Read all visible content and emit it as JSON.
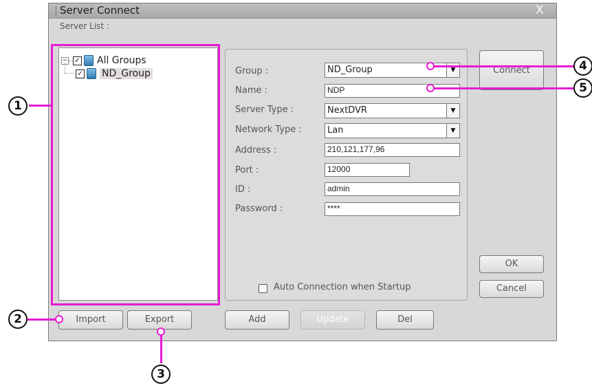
{
  "window": {
    "title": "Server Connect",
    "close_glyph": "X"
  },
  "server_list": {
    "label": "Server List :",
    "tree": [
      {
        "label": "All Groups",
        "expander": "−",
        "checked": true,
        "icon": "server-icon"
      },
      {
        "label": "ND_Group",
        "checked": true,
        "icon": "server-icon",
        "selected": true
      }
    ]
  },
  "form": {
    "group": {
      "label": "Group :",
      "value": "ND_Group"
    },
    "name": {
      "label": "Name :",
      "value": "NDP"
    },
    "server_type": {
      "label": "Server Type :",
      "value": "NextDVR"
    },
    "network_type": {
      "label": "Network Type :",
      "value": "Lan"
    },
    "address": {
      "label": "Address :",
      "value": "210,121,177,96"
    },
    "port": {
      "label": "Port :",
      "value": "12000"
    },
    "id": {
      "label": "ID :",
      "value": "admin"
    },
    "password": {
      "label": "Password :",
      "value": "****"
    },
    "auto_connection": {
      "label": "Auto Connection when Startup",
      "checked": false
    }
  },
  "buttons": {
    "connect": "Connect",
    "ok": "OK",
    "cancel": "Cancel",
    "import": "Import",
    "export": "Export",
    "add": "Add",
    "update": "Update",
    "del": "Del"
  },
  "callouts": [
    "1",
    "2",
    "3",
    "4",
    "5"
  ],
  "colors": {
    "callout": "#e81ad3",
    "window_bg": "#d8d8d8",
    "titlebar": "#b3b3b3"
  }
}
